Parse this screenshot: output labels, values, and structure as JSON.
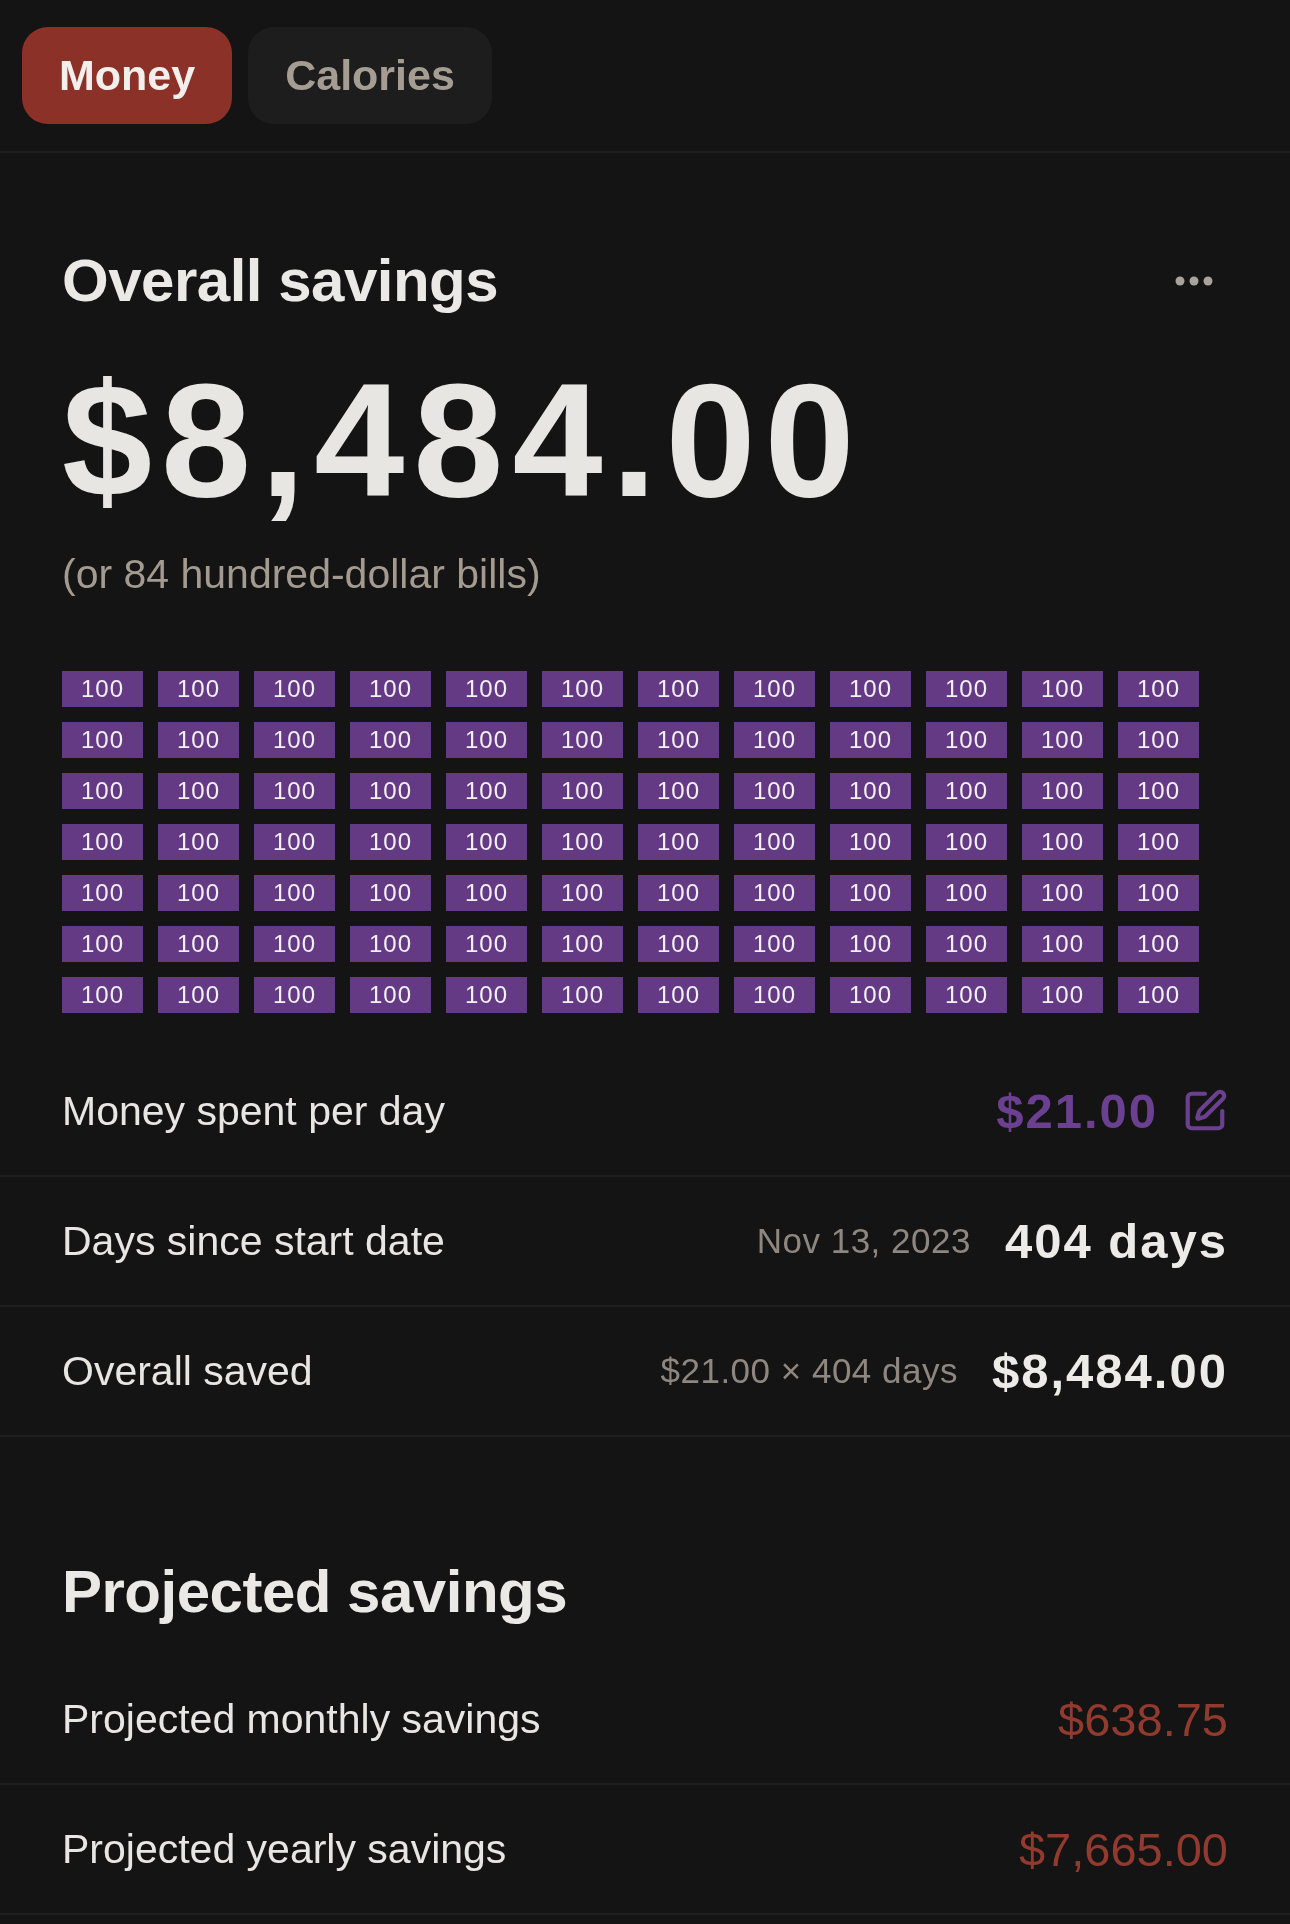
{
  "tabs": [
    {
      "label": "Money",
      "selected": true
    },
    {
      "label": "Calories",
      "selected": false
    }
  ],
  "overall": {
    "title": "Overall savings",
    "amount": "$8,484.00",
    "subtitle": "(or 84 hundred-dollar bills)",
    "bills": [
      "100",
      "100",
      "100",
      "100",
      "100",
      "100",
      "100",
      "100",
      "100",
      "100",
      "100",
      "100",
      "100",
      "100",
      "100",
      "100",
      "100",
      "100",
      "100",
      "100",
      "100",
      "100",
      "100",
      "100",
      "100",
      "100",
      "100",
      "100",
      "100",
      "100",
      "100",
      "100",
      "100",
      "100",
      "100",
      "100",
      "100",
      "100",
      "100",
      "100",
      "100",
      "100",
      "100",
      "100",
      "100",
      "100",
      "100",
      "100",
      "100",
      "100",
      "100",
      "100",
      "100",
      "100",
      "100",
      "100",
      "100",
      "100",
      "100",
      "100",
      "100",
      "100",
      "100",
      "100",
      "100",
      "100",
      "100",
      "100",
      "100",
      "100",
      "100",
      "100",
      "100",
      "100",
      "100",
      "100",
      "100",
      "100",
      "100",
      "100",
      "100",
      "100",
      "100",
      "100"
    ],
    "rows": [
      {
        "kind": "editable",
        "label": "Money spent per day",
        "value": "$21.00"
      },
      {
        "kind": "computed",
        "label": "Days since start date",
        "detail": "Nov 13, 2023",
        "value": "404 days"
      },
      {
        "kind": "computed",
        "label": "Overall saved",
        "detail": "$21.00 × 404 days",
        "value": "$8,484.00"
      }
    ]
  },
  "projected": {
    "title": "Projected savings",
    "rows": [
      {
        "label": "Projected monthly savings",
        "value": "$638.75"
      },
      {
        "label": "Projected yearly savings",
        "value": "$7,665.00"
      }
    ]
  }
}
